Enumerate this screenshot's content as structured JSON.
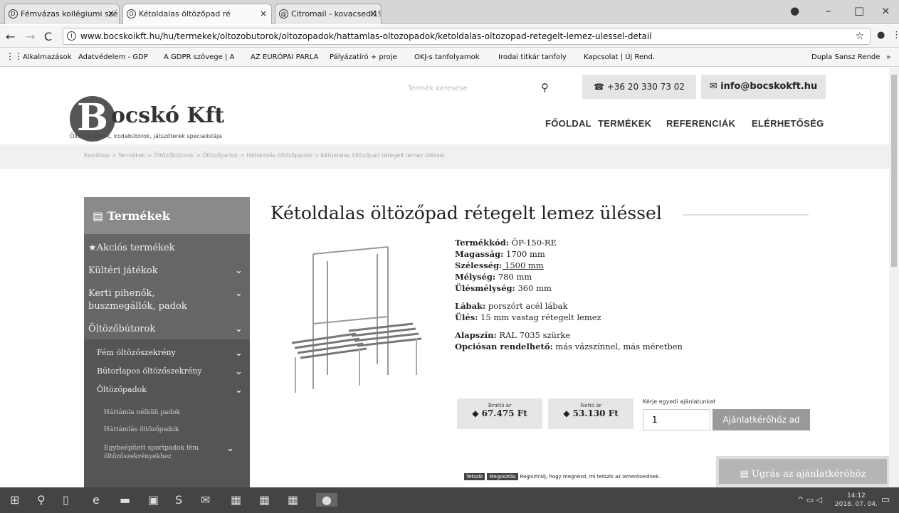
{
  "tabs": [
    {
      "title": "Fémvázas kollégiumi szé",
      "icon": "page-icon"
    },
    {
      "title": "Kétoldalas öltözőpad ré",
      "icon": "page-icon"
    },
    {
      "title": "Citromail - kovacsedi19",
      "icon": "mail-icon"
    }
  ],
  "url": "www.bocskoikft.hu/hu/termekek/oltozobutorok/oltozopadok/hattamlas-oltozopadok/ketoldalas-oltozopad-retegelt-lemez-ulessel-detail",
  "bookmarks": [
    "Alkalmazások",
    "Adatvédelem - GDP",
    "A GDPR szövege | A",
    "AZ EURÓPAI PARLA",
    "Pályázatíró + proje",
    "OKJ-s tanfolyamok",
    "Irodai titkár tanfoly",
    "Kapcsolat | Új Rend.",
    "Dupla Sansz Rende"
  ],
  "site": {
    "logo_letter": "B",
    "logo_name": "ocskó Kft",
    "tagline": "Öltözőbútorok, irodabútorok, játszóterek specialistája",
    "search_placeholder": "Termék keresése",
    "phone": "☎ +36 20 330 73 02",
    "email": "✉ info@bocskokft.hu",
    "nav": [
      "FŐOLDAL",
      "TERMÉKEK",
      "REFERENCIÁK",
      "ELÉRHETŐSÉG"
    ],
    "breadcrumb": "Kezdőlap  >  Termékek  >  Öltözőbútorok  >  Öltözőpadok  >  Háttámlás öltözőpadok  >  Kétoldalas öltözőpad rétegelt lemez üléssel"
  },
  "sidebar": {
    "title": "Termékek",
    "items": [
      {
        "label": "★Akciós termékek"
      },
      {
        "label": "Kültéri játékok"
      },
      {
        "label": "Kerti pihenők,"
      },
      {
        "label": "buszmegállók, padok"
      },
      {
        "label": "Öltözőbútorok"
      },
      {
        "label": "Fém öltözőszekrény"
      },
      {
        "label": "Bútorlapos öltözőszekrény"
      },
      {
        "label": "Öltözőpadok"
      },
      {
        "label": "Háttámla nélküli padok"
      },
      {
        "label": "Háttámlás öltözőpadok"
      },
      {
        "label": "Egybeépített sportpadok fém"
      },
      {
        "label": "öltözőszekrényekhez"
      }
    ]
  },
  "product": {
    "title": "Kétoldalas öltözőpad rétegelt lemez üléssel",
    "specs": [
      {
        "k": "Termékkód:",
        "v": " ÖP-150-RE"
      },
      {
        "k": "Magasság:",
        "v": " 1700 mm"
      },
      {
        "k": "Szélesség:",
        "v": " 1500 mm"
      },
      {
        "k": "Mélység:",
        "v": " 780 mm"
      },
      {
        "k": "Ülésmélység:",
        "v": " 360 mm"
      },
      {
        "k": "Lábak:",
        "v": " porszórt acél lábak"
      },
      {
        "k": "Ülés:",
        "v": " 15 mm vastag rétegelt lemez"
      },
      {
        "k": "Alapszín:",
        "v": " RAL 7035 szürke"
      },
      {
        "k": "Opciósan rendelhető:",
        "v": " más vázszínnel, más méretben"
      }
    ],
    "gross_label": "Bruttó ár",
    "gross": "◆ 67.475 Ft",
    "net_label": "Nettó ár",
    "net": "◆ 53.130 Ft",
    "quote_label": "Kérje egyedi ajánlatunkat",
    "qty": "1",
    "quote_button": "Ajánlatkérőhöz ad",
    "like": "Tetszik",
    "share": "Megosztás",
    "social_text": "Regisztrálj, hogy megnézd, mi tetszik az ismerőseidnek.",
    "jump_button": "▤ Ugrás az ajánlatkérőhöz"
  },
  "taskbar": {
    "time": "14:12",
    "date": "2018. 07. 04."
  }
}
